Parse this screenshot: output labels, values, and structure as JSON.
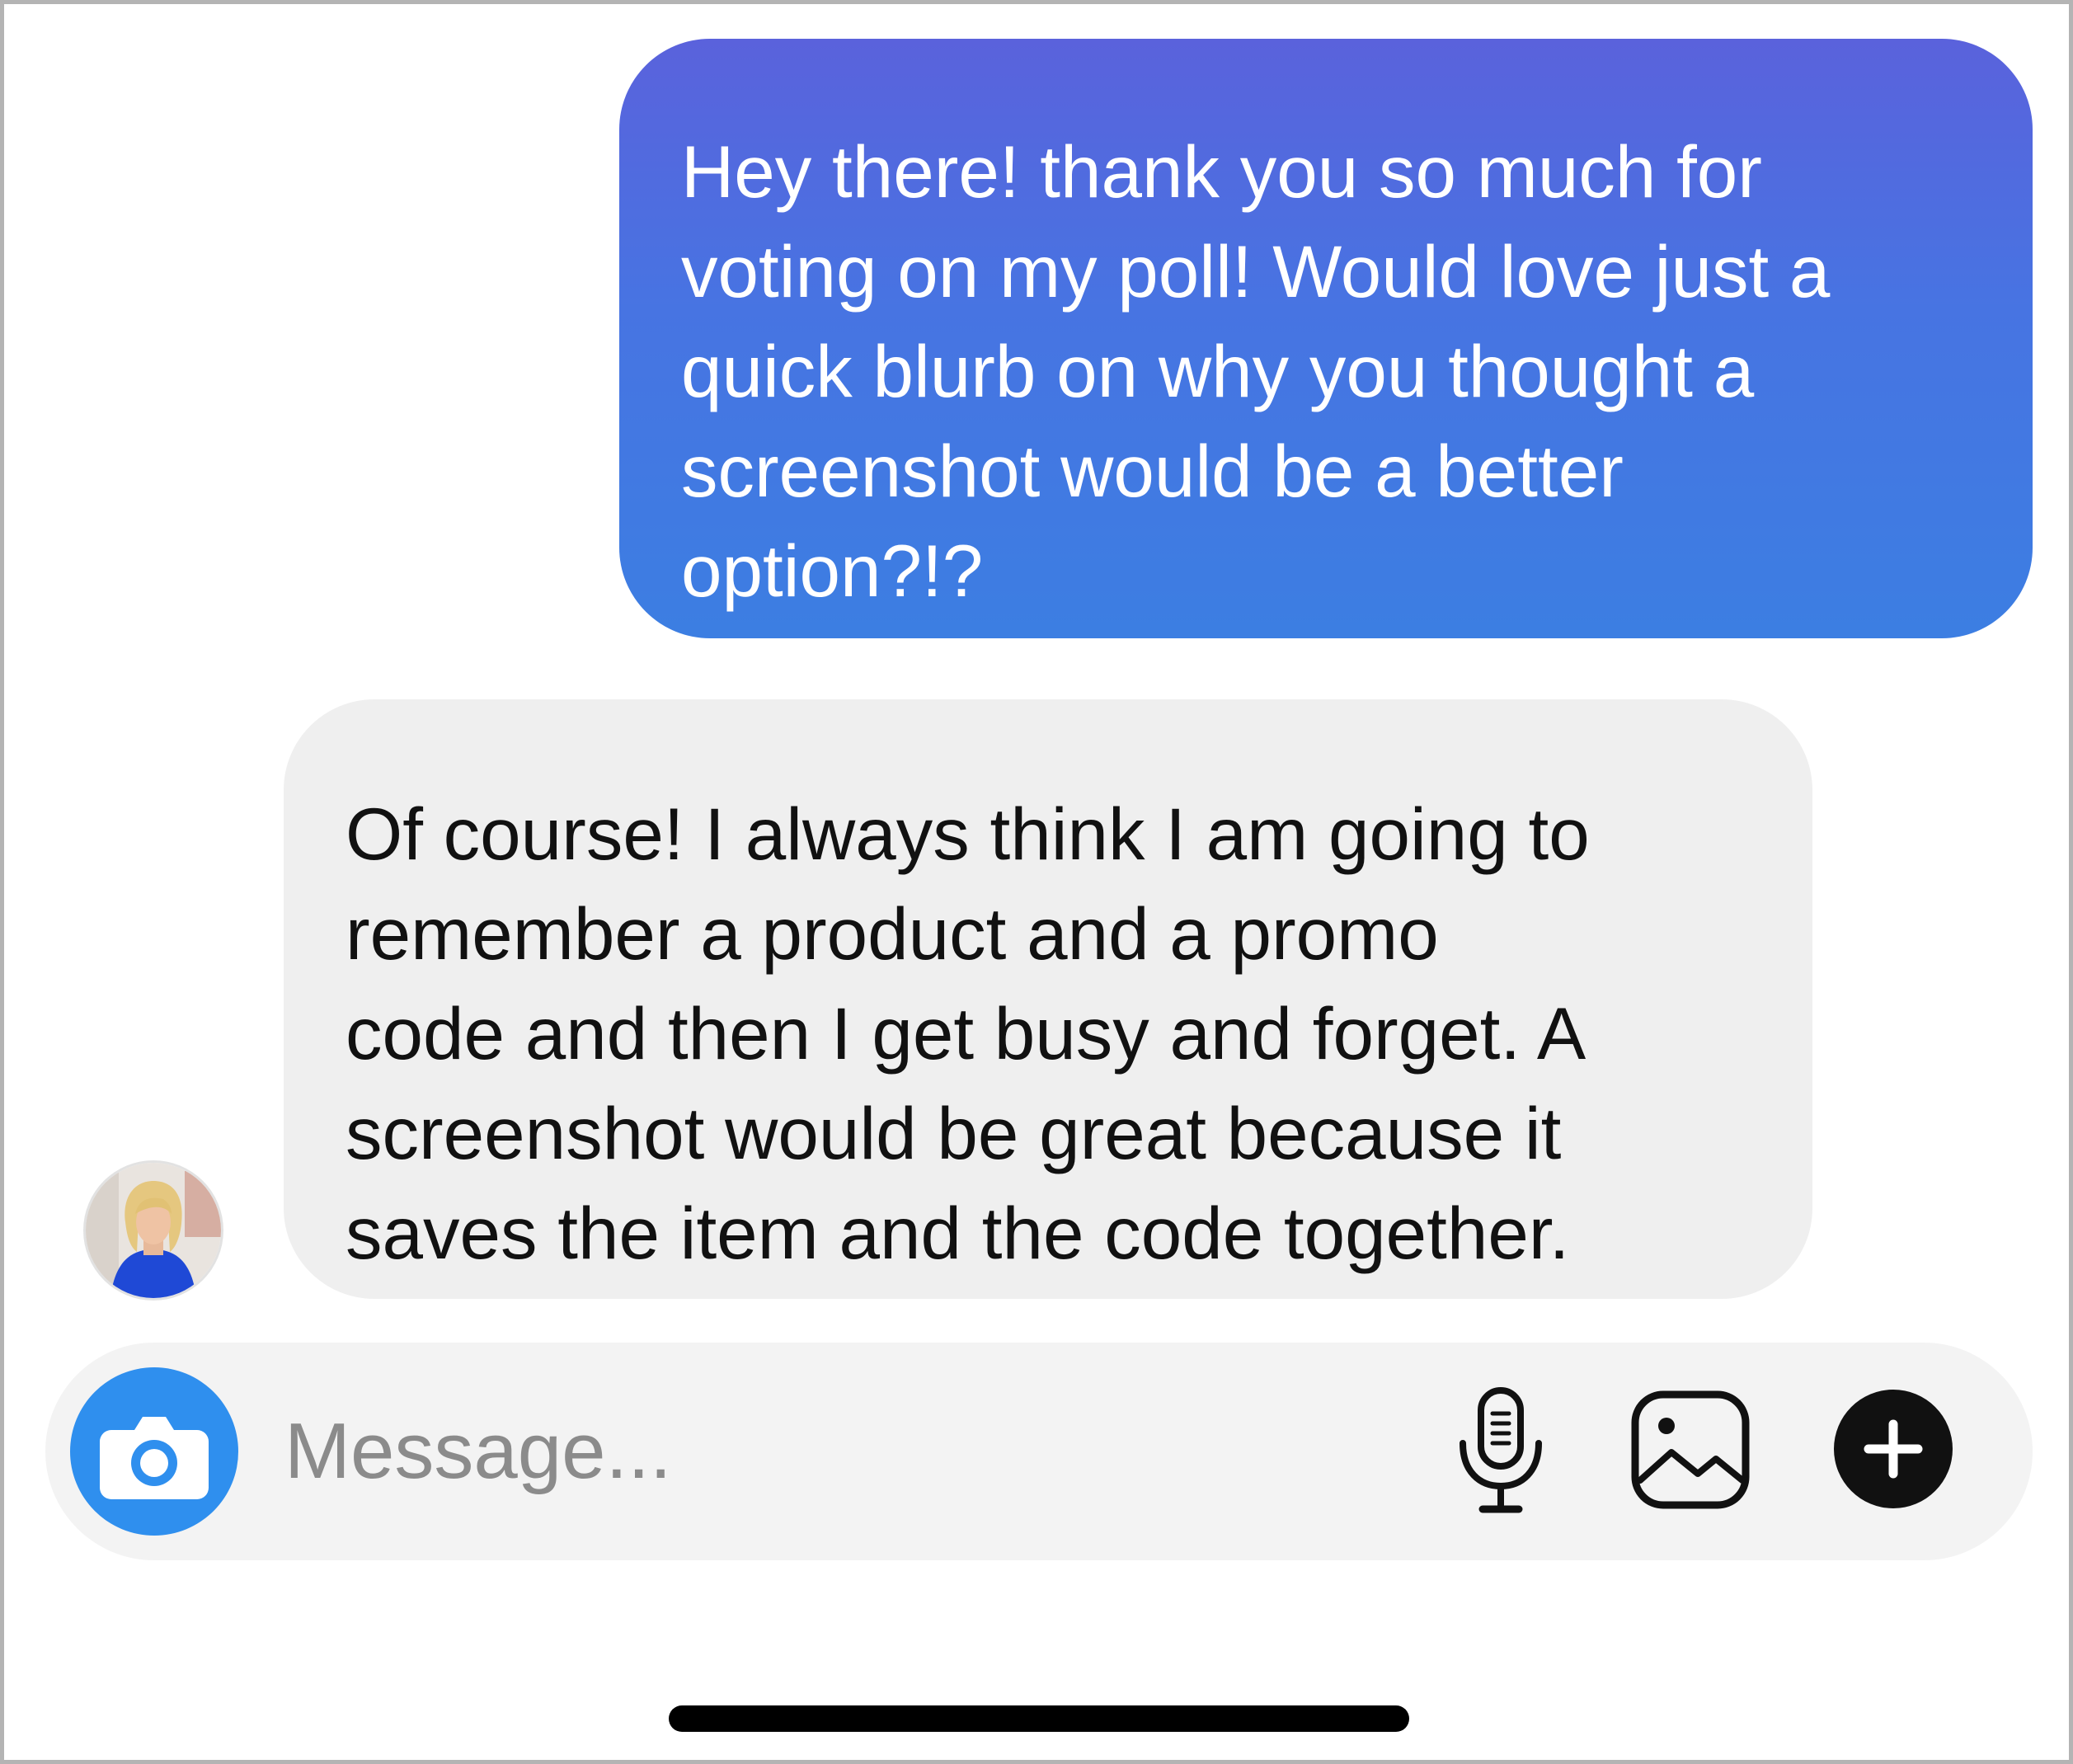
{
  "messages": [
    {
      "direction": "outgoing",
      "text": "Hey there! thank you so much for\nvoting on my poll! Would love just a\nquick blurb on why you thought a\nscreenshot would be a better\noption?!?"
    },
    {
      "direction": "incoming",
      "text": "Of course! I always think I am going to\nremember a product and a promo\ncode and then I get busy and forget. A\nscreenshot would be great because it\nsaves the item and the code together."
    }
  ],
  "composer": {
    "placeholder": "Message...",
    "icons": [
      "camera-icon",
      "microphone-icon",
      "gallery-icon",
      "plus-icon"
    ]
  },
  "colors": {
    "outgoing_bubble_top": "#5a62dc",
    "outgoing_bubble_bottom": "#3c7ee2",
    "incoming_bubble": "#efefef",
    "camera_button": "#2f8fee",
    "plus_button": "#111111"
  }
}
